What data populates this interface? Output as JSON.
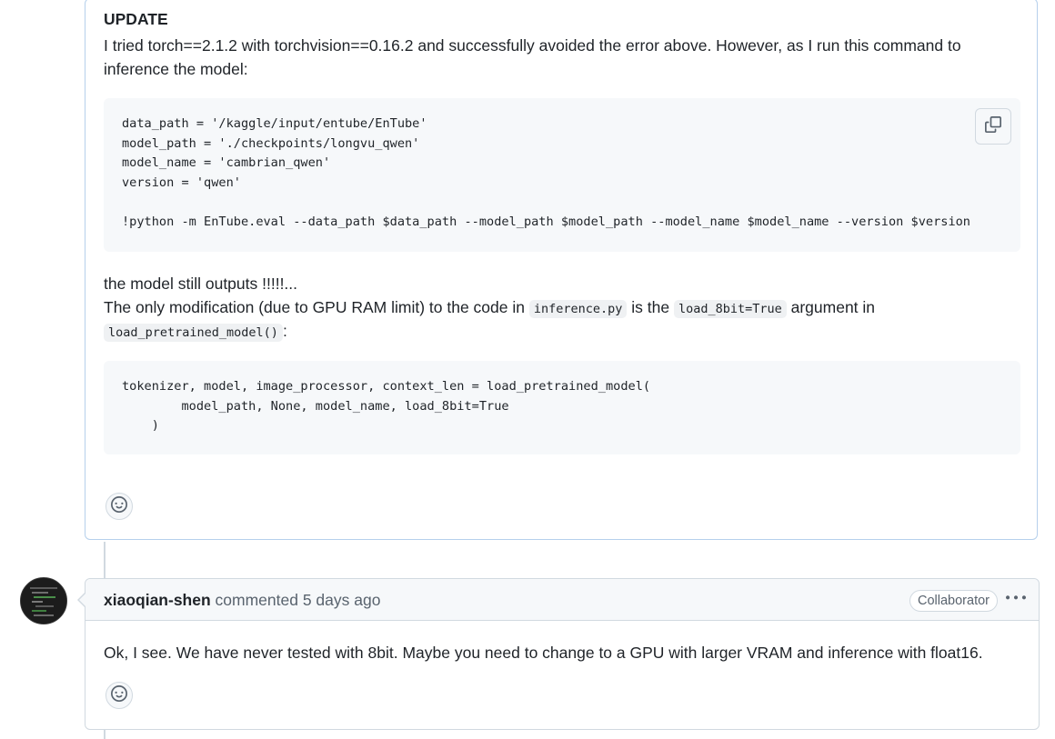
{
  "comment1": {
    "update_heading": "UPDATE",
    "paragraph1": "I tried torch==2.1.2 with torchvision==0.16.2 and successfully avoided the error above. However, as I run this command to inference the model:",
    "code_block1": "data_path = '/kaggle/input/entube/EnTube'\nmodel_path = './checkpoints/longvu_qwen'\nmodel_name = 'cambrian_qwen'\nversion = 'qwen'\n\n!python -m EnTube.eval --data_path $data_path --model_path $model_path --model_name $model_name --version $version",
    "paragraph2": "the model still outputs !!!!!...",
    "paragraph3_prefix": "The only modification (due to GPU RAM limit) to the code in ",
    "paragraph3_code1": "inference.py",
    "paragraph3_mid": " is the ",
    "paragraph3_code2": "load_8bit=True",
    "paragraph3_suffix": " argument in",
    "paragraph4_code": "load_pretrained_model()",
    "paragraph4_suffix": ":",
    "code_block2": "tokenizer, model, image_processor, context_len = load_pretrained_model(\n        model_path, None, model_name, load_8bit=True\n    )"
  },
  "comment2": {
    "author": "xiaoqian-shen",
    "action": " commented ",
    "timestamp": "5 days ago",
    "role_badge": "Collaborator",
    "body": "Ok, I see. We have never tested with 8bit. Maybe you need to change to a GPU with larger VRAM and inference with float16."
  },
  "icons": {
    "copy": "copy-icon",
    "smiley": "smiley-icon",
    "kebab": "kebab-horizontal-icon"
  },
  "colors": {
    "border_highlight": "#b6d0ec",
    "border": "#d1d9e0",
    "code_bg": "#f6f8fa",
    "text": "#1f2328",
    "muted": "#59636e"
  }
}
